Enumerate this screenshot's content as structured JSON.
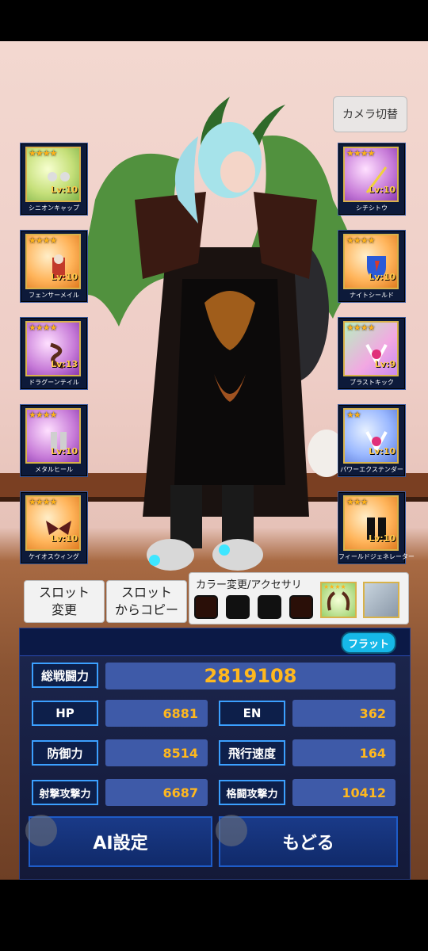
{
  "camera_button": "カメラ切替",
  "left_slots": [
    {
      "stars": "★★★★",
      "level": "Lv:10",
      "name": "シニオンキャップ"
    },
    {
      "stars": "★★★★",
      "level": "Lv:10",
      "name": "フェンサーメイル"
    },
    {
      "stars": "★★★★",
      "level": "Lv:13",
      "name": "ドラグーンテイル"
    },
    {
      "stars": "★★★★",
      "level": "Lv:10",
      "name": "メタルヒール"
    },
    {
      "stars": "★★★★",
      "level": "Lv:10",
      "name": "ケイオスウィング"
    }
  ],
  "right_slots": [
    {
      "stars": "★★★★",
      "level": "Lv:10",
      "name": "シチシトウ"
    },
    {
      "stars": "★★★★",
      "level": "Lv:10",
      "name": "ナイトシールド"
    },
    {
      "stars": "★★★★",
      "level": "Lv:9",
      "name": "ブラストキック"
    },
    {
      "stars": "★★",
      "level": "Lv:10",
      "name": "パワーエクステンダー"
    },
    {
      "stars": "★★★",
      "level": "Lv:10",
      "name": "フィールドジェネレーター"
    }
  ],
  "slot_change": {
    "line1": "スロット",
    "line2": "変更"
  },
  "slot_copy": {
    "line1": "スロット",
    "line2": "からコピー"
  },
  "color_panel_title": "カラー変更/アクセサリ",
  "accessory_stars": "★★★★",
  "flat_badge": "フラット",
  "stats": {
    "total_label": "総戦闘力",
    "total_value": "2819108",
    "hp_label": "HP",
    "hp_value": "6881",
    "en_label": "EN",
    "en_value": "362",
    "def_label": "防御力",
    "def_value": "8514",
    "speed_label": "飛行速度",
    "speed_value": "164",
    "shoot_label": "射撃攻撃力",
    "shoot_value": "6687",
    "melee_label": "格闘攻撃力",
    "melee_value": "10412"
  },
  "ai_button": "AI設定",
  "back_button": "もどる",
  "colors": {
    "accent": "#ffb81e",
    "panel": "#122250",
    "label_border": "#3ba0ff",
    "badge": "#16b8e8"
  }
}
